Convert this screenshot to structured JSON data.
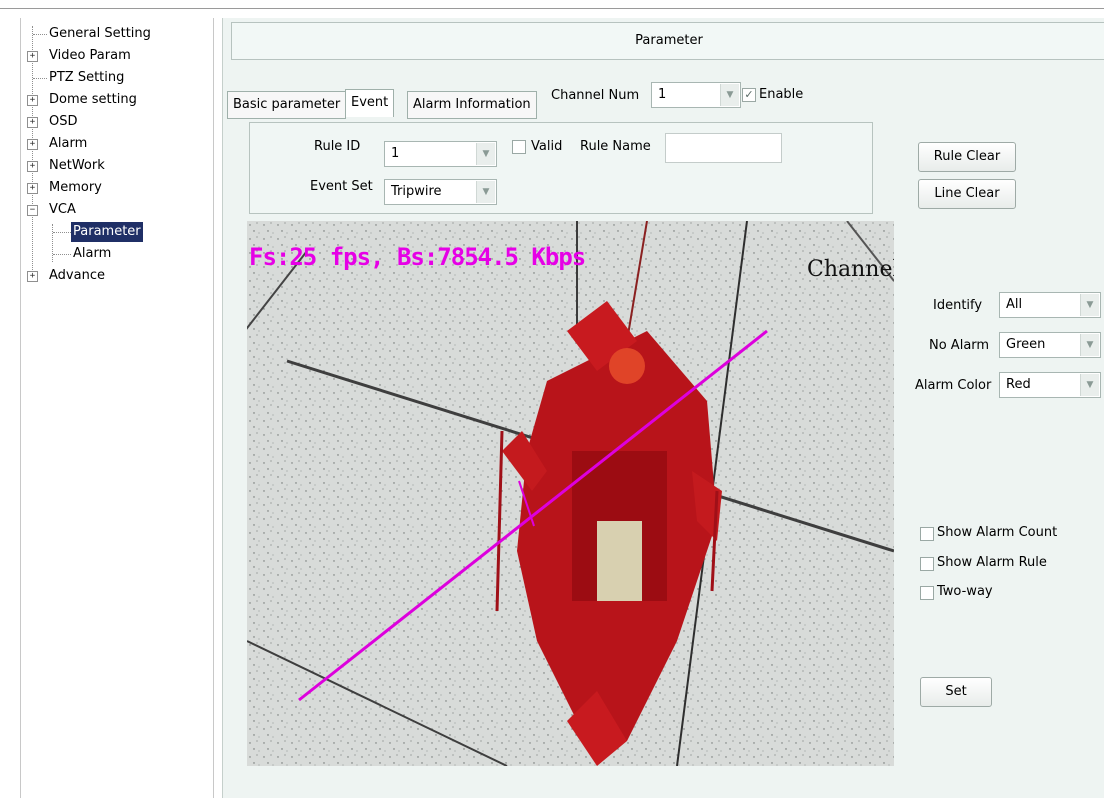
{
  "sidebar": {
    "items": [
      {
        "label": "General Setting"
      },
      {
        "label": "Video Param"
      },
      {
        "label": "PTZ Setting"
      },
      {
        "label": "Dome setting"
      },
      {
        "label": "OSD"
      },
      {
        "label": "Alarm"
      },
      {
        "label": "NetWork"
      },
      {
        "label": "Memory"
      },
      {
        "label": "VCA"
      },
      {
        "label": "Parameter"
      },
      {
        "label": "Alarm"
      },
      {
        "label": "Advance"
      }
    ],
    "expand_glyph": "+",
    "collapse_glyph": "−"
  },
  "header": {
    "title": "Parameter"
  },
  "tabs": [
    {
      "label": "Basic parameter"
    },
    {
      "label": "Event"
    },
    {
      "label": "Alarm Information"
    }
  ],
  "channel": {
    "label": "Channel Num",
    "value": "1",
    "enable_label": "Enable"
  },
  "rule": {
    "id_label": "Rule ID",
    "id_value": "1",
    "valid_label": "Valid",
    "name_label": "Rule Name",
    "name_value": "",
    "event_label": "Event Set",
    "event_value": "Tripwire"
  },
  "buttons": {
    "rule_clear": "Rule Clear",
    "line_clear": "Line Clear",
    "set": "Set"
  },
  "video": {
    "osd": "Fs:25 fps, Bs:7854.5 Kbps",
    "channel": "Channel"
  },
  "display": {
    "identify_label": "Identify",
    "identify_value": "All",
    "no_alarm_label": "No Alarm",
    "no_alarm_value": "Green",
    "alarm_color_label": "Alarm Color",
    "alarm_color_value": "Red"
  },
  "options": {
    "show_alarm_count": "Show Alarm Count",
    "show_alarm_rule": "Show Alarm Rule",
    "two_way": "Two-way"
  },
  "icons": {
    "dropdown": "▼",
    "check": "✓"
  },
  "colors": {
    "accent": "#e600e6",
    "selected": "#1f2f66",
    "panel": "#eef4f2"
  }
}
